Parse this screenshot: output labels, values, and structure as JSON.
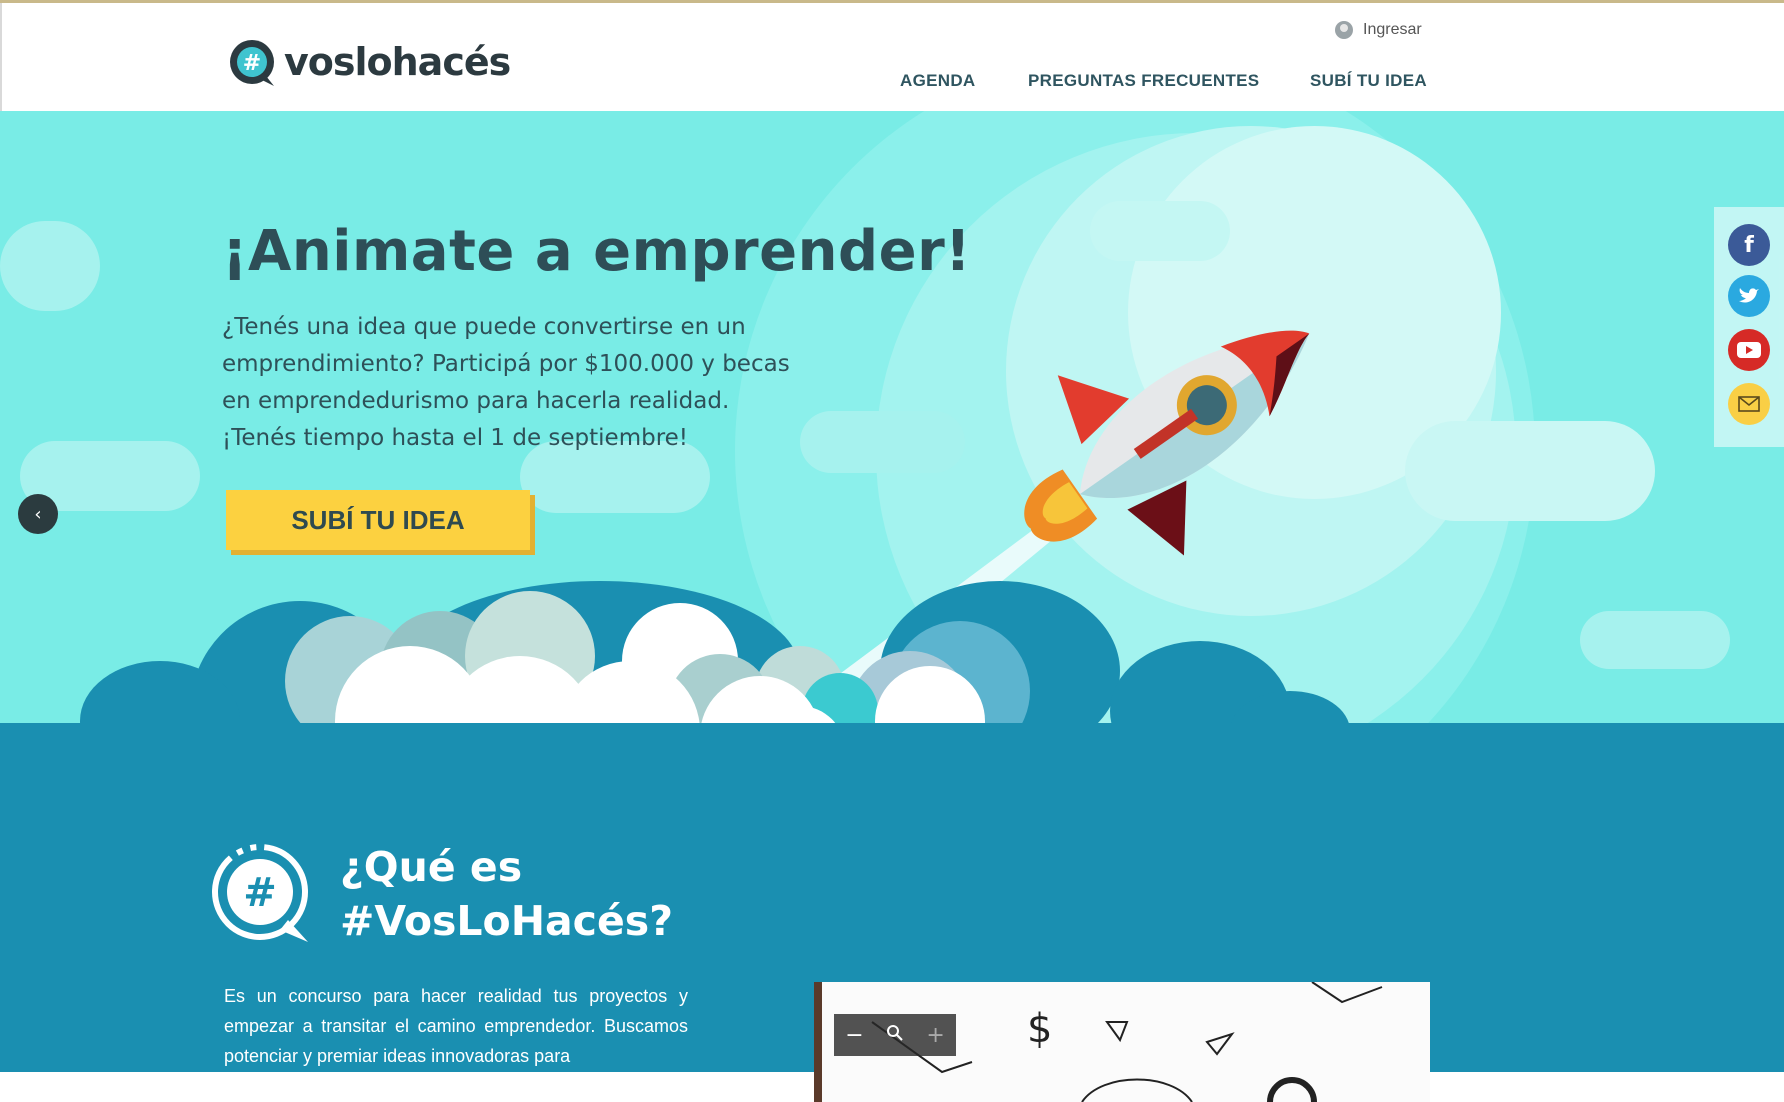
{
  "header": {
    "logo_text": "voslohacés",
    "login_label": "Ingresar",
    "nav": [
      "AGENDA",
      "PREGUNTAS FRECUENTES",
      "SUBÍ TU IDEA"
    ]
  },
  "hero": {
    "title": "¡Animate a emprender!",
    "text": "¿Tenés una idea que puede convertirse en un emprendimiento? Participá por $100.000 y becas en emprendedurismo para hacerla realidad. ¡Tenés tiempo hasta el 1 de septiembre!",
    "cta_label": "SUBÍ TU IDEA",
    "prev_icon": "chevron-left-icon"
  },
  "social": {
    "items": [
      {
        "name": "facebook-icon",
        "glyph": "f",
        "color": "#3b5a98"
      },
      {
        "name": "twitter-icon",
        "glyph": "t",
        "color": "#2aa9e0"
      },
      {
        "name": "youtube-icon",
        "glyph": "▶",
        "color": "#d62a26"
      },
      {
        "name": "mail-icon",
        "glyph": "✉",
        "color": "#f9cf45"
      }
    ]
  },
  "about": {
    "title_line1": "¿Qué es",
    "title_line2": "#VosLoHacés?",
    "text": "Es un concurso para hacer realidad tus proyectos y empezar a transitar el camino emprendedor. Buscamos potenciar y premiar ideas innovadoras para",
    "zoom_out": "−",
    "zoom_icon": "zoom-icon",
    "zoom_in": "+"
  },
  "colors": {
    "hero_bg": "#79ece6",
    "section_bg": "#1a8fb1",
    "cta": "#fcd140",
    "rocket_red": "#e23c2e"
  }
}
